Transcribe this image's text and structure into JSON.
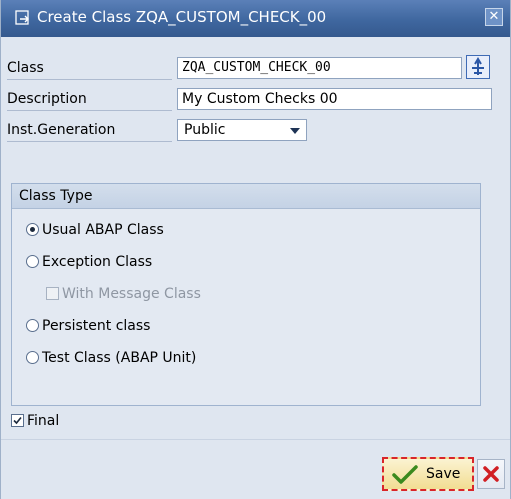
{
  "window": {
    "title": "Create Class ZQA_CUSTOM_CHECK_00"
  },
  "form": {
    "class_label": "Class",
    "class_value": "ZQA_CUSTOM_CHECK_00",
    "description_label": "Description",
    "description_value": "My Custom Checks 00",
    "inst_generation_label": "Inst.Generation",
    "inst_generation_value": "Public"
  },
  "class_type": {
    "title": "Class Type",
    "options": [
      {
        "label": "Usual ABAP Class",
        "selected": true
      },
      {
        "label": "Exception Class",
        "selected": false
      },
      {
        "label": "Persistent class",
        "selected": false
      },
      {
        "label": "Test Class (ABAP Unit)",
        "selected": false
      }
    ],
    "with_message_class": {
      "label": "With Message Class",
      "checked": false,
      "enabled": false
    }
  },
  "final": {
    "label": "Final",
    "checked": true
  },
  "buttons": {
    "save_label": "Save"
  },
  "icons": {
    "title": "window-icon",
    "search_help": "search-help-icon",
    "save": "checkmark-icon",
    "cancel": "x-icon"
  },
  "colors": {
    "titlebar": "#3f679f",
    "dialog_bg": "#dfe6f0",
    "save_border": "#d9252a",
    "cancel_icon": "#d11f24",
    "checkmark": "#3b8a1e"
  }
}
